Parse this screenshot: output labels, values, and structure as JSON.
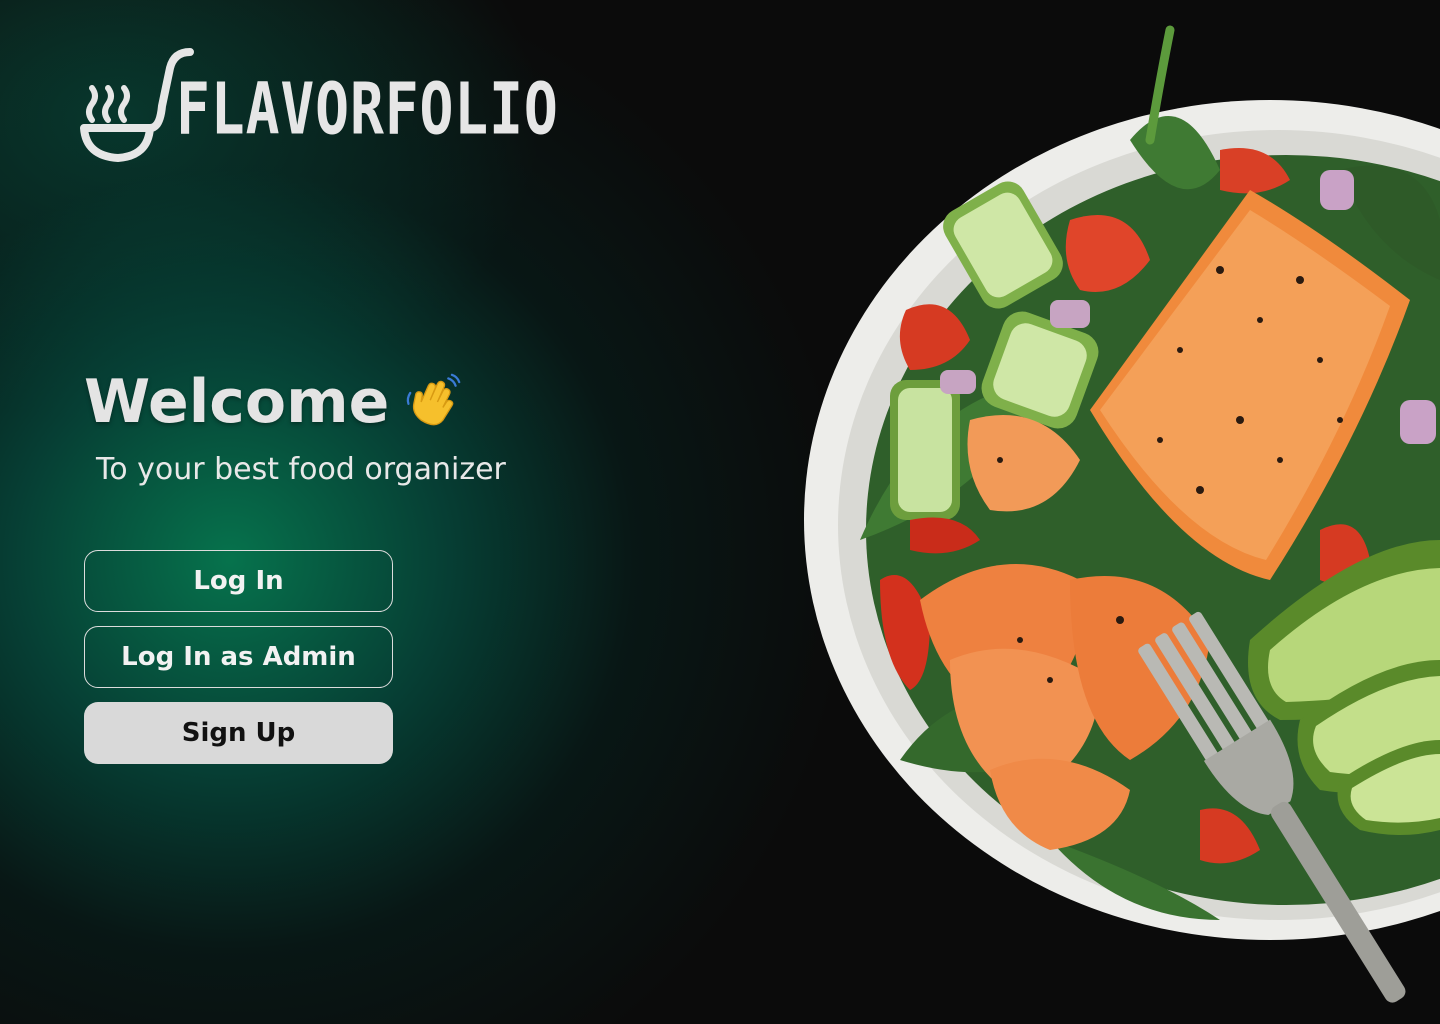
{
  "app": {
    "brand_name": "FLAVORFOLIO"
  },
  "hero": {
    "title": "Welcome",
    "wave_icon": "waving-hand-icon",
    "subtitle": "To your best food organizer"
  },
  "actions": {
    "login_label": "Log In",
    "admin_login_label": "Log In as Admin",
    "signup_label": "Sign Up"
  },
  "colors": {
    "background": "#0b0b0b",
    "accent_green": "#067850",
    "button_outline": "#dcdcdc",
    "signup_bg": "#d9d9d9",
    "text_light": "#e6e6e6"
  }
}
